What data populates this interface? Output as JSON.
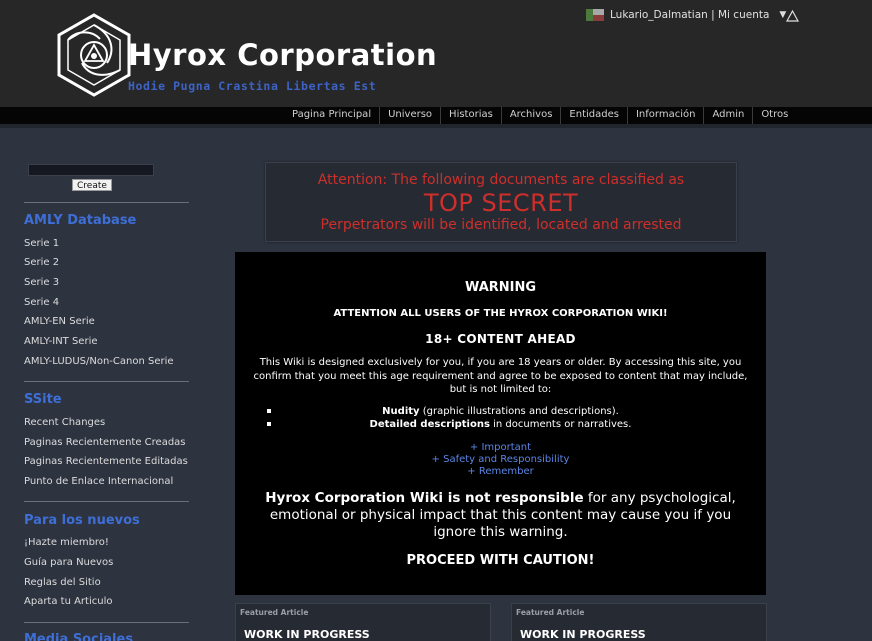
{
  "header": {
    "site_title": "Hyrox Corporation",
    "motto": "Hodie Pugna Crastina Libertas Est",
    "user_text": "Lukario_Dalmatian | Mi cuenta",
    "user_caret": "▼"
  },
  "nav": {
    "items": [
      "Pagina Principal",
      "Universo",
      "Historias",
      "Archivos",
      "Entidades",
      "Información",
      "Admin",
      "Otros"
    ]
  },
  "sidebar": {
    "search_placeholder": "",
    "create_label": "Create",
    "sections": [
      {
        "title": "AMLY Database",
        "items": [
          "Serie 1",
          "Serie 2",
          "Serie 3",
          "Serie 4",
          "AMLY-EN Serie",
          "AMLY-INT Serie",
          "AMLY-LUDUS/Non-Canon Serie"
        ]
      },
      {
        "title": "SSite",
        "items": [
          "Recent Changes",
          "Paginas Recientemente Creadas",
          "Paginas Recientemente Editadas",
          "Punto de Enlace Internacional"
        ]
      },
      {
        "title": "Para los nuevos",
        "items": [
          "¡Hazte miembro!",
          "Guía para Nuevos",
          "Reglas del Sitio",
          "Aparta tu Articulo"
        ]
      },
      {
        "title": "Media   Sociales",
        "items": []
      }
    ]
  },
  "attention": {
    "line1": "Attention: The following documents are classified as",
    "line2": "TOP SECRET",
    "line3": "Perpetrators will be identified, located and arrested"
  },
  "warning": {
    "title": "WARNING",
    "subtitle": "ATTENTION ALL USERS OF THE HYROX CORPORATION WIKI!",
    "content_ahead": "18+ CONTENT AHEAD",
    "paragraph": "This Wiki is designed exclusively for you, if you are 18 years or older. By accessing this site, you confirm that you meet this age requirement and agree to be exposed to content that may include, but is not limited to:",
    "list": [
      {
        "bold": "Nudity",
        "rest": " (graphic illustrations and descriptions)."
      },
      {
        "bold": "Detailed descriptions",
        "rest": " in documents or narratives."
      }
    ],
    "links": [
      "+ Important",
      "+ Safety and Responsibility",
      "+ Remember"
    ],
    "resp_bold": "Hyrox Corporation Wiki is not responsible",
    "resp_rest": " for any psychological, emotional or physical impact that this content may cause you if you ignore this warning.",
    "proceed": "PROCEED WITH CAUTION!"
  },
  "featured": [
    {
      "label": "Featured Article",
      "title": "WORK IN PROGRESS"
    },
    {
      "label": "Featured Article",
      "title": "WORK IN PROGRESS"
    }
  ],
  "colors": {
    "page_bg": "#2e3340",
    "header_bg": "#272727",
    "accent_blue": "#3d6fd6",
    "alert_red": "#cf2f2a",
    "link_blue": "#5b86e6"
  },
  "icons": [
    "logo-emblem-icon",
    "user-flag-icon",
    "alert-triangle-icon"
  ]
}
